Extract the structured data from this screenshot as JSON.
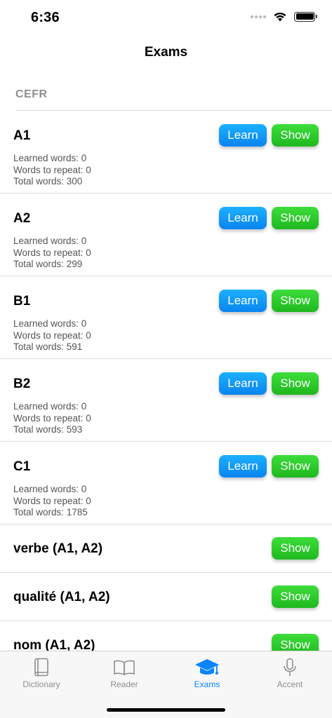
{
  "status_bar": {
    "time": "6:36"
  },
  "nav": {
    "title": "Exams"
  },
  "section": {
    "header": "CEFR"
  },
  "rows": [
    {
      "title": "A1",
      "learned": "Learned words: 0",
      "repeat": "Words to repeat: 0",
      "total": "Total words: 300",
      "learn_label": "Learn",
      "show_label": "Show"
    },
    {
      "title": "A2",
      "learned": "Learned words: 0",
      "repeat": "Words to repeat: 0",
      "total": "Total words: 299",
      "learn_label": "Learn",
      "show_label": "Show"
    },
    {
      "title": "B1",
      "learned": "Learned words: 0",
      "repeat": "Words to repeat: 0",
      "total": "Total words: 591",
      "learn_label": "Learn",
      "show_label": "Show"
    },
    {
      "title": "B2",
      "learned": "Learned words: 0",
      "repeat": "Words to repeat: 0",
      "total": "Total words: 593",
      "learn_label": "Learn",
      "show_label": "Show"
    },
    {
      "title": "C1",
      "learned": "Learned words: 0",
      "repeat": "Words to repeat: 0",
      "total": "Total words: 1785",
      "learn_label": "Learn",
      "show_label": "Show"
    },
    {
      "title": "verbe (A1, A2)",
      "show_label": "Show"
    },
    {
      "title": "qualité (A1, A2)",
      "show_label": "Show"
    },
    {
      "title": "nom (A1, A2)",
      "show_label": "Show"
    }
  ],
  "tabs": [
    {
      "label": "Dictionary",
      "icon": "book-icon",
      "active": false
    },
    {
      "label": "Reader",
      "icon": "open-book-icon",
      "active": false
    },
    {
      "label": "Exams",
      "icon": "graduation-cap-icon",
      "active": true
    },
    {
      "label": "Accent",
      "icon": "microphone-icon",
      "active": false
    }
  ],
  "colors": {
    "accent": "#0a84ff",
    "learn_button": "#0a9cf8",
    "show_button": "#2ecc2e",
    "separator": "#dcdcdc",
    "secondary_text": "#8e8e93"
  }
}
